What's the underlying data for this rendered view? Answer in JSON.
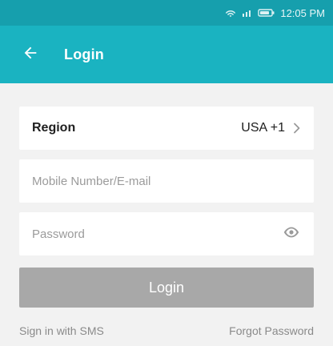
{
  "status_bar": {
    "time": "12:05 PM",
    "icons": [
      "wifi-icon",
      "signal-icon",
      "battery-icon"
    ]
  },
  "app_bar": {
    "back_icon": "arrow-left-icon",
    "title": "Login"
  },
  "form": {
    "region": {
      "label": "Region",
      "value": "USA +1",
      "chevron_icon": "chevron-right-icon"
    },
    "mobile": {
      "placeholder": "Mobile Number/E-mail",
      "value": ""
    },
    "password": {
      "placeholder": "Password",
      "value": "",
      "toggle_icon": "eye-icon"
    },
    "login_button_label": "Login"
  },
  "links": {
    "sms_label": "Sign in with SMS",
    "forgot_label": "Forgot Password"
  },
  "colors": {
    "status_bar": "#169fad",
    "app_bar": "#1ab3c1",
    "background": "#f2f2f2",
    "disabled_button": "#a8a8a8",
    "muted_text": "#8a8a8a"
  }
}
